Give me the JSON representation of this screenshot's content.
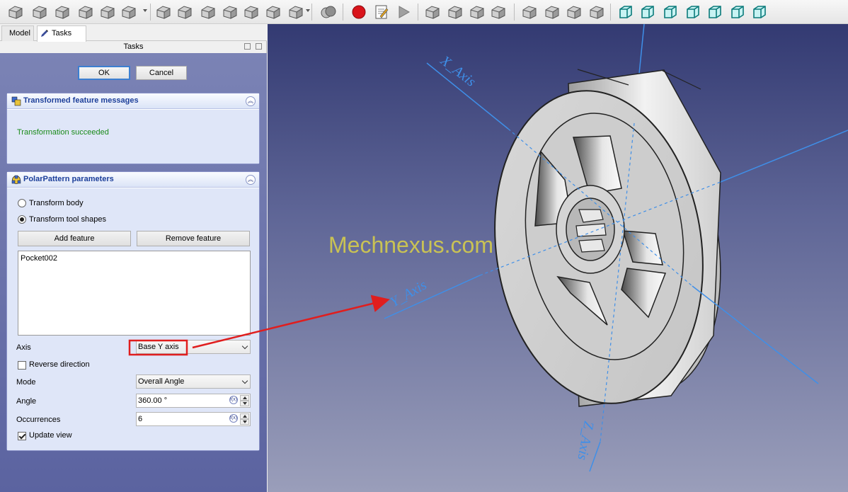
{
  "toolbar": {
    "icons": [
      "pad-icon",
      "revolution-icon",
      "additive-loft-icon",
      "additive-pipe-icon",
      "additive-helix-icon",
      "additive-primitive-icon",
      "pocket-icon",
      "hole-icon",
      "groove-icon",
      "subtractive-loft-icon",
      "subtractive-pipe-icon",
      "subtractive-helix-icon",
      "subtractive-primitive-icon",
      "boolean-icon",
      "macro-record-icon",
      "macro-edit-icon",
      "macro-execute-icon",
      "fillet-icon",
      "chamfer-icon",
      "draft-icon",
      "thickness-icon",
      "mirrored-icon",
      "linear-pattern-icon",
      "polar-pattern-icon",
      "multi-transform-icon",
      "view-isometric-icon",
      "view-front-icon",
      "view-top-icon",
      "view-right-icon",
      "view-rear-icon",
      "view-bottom-icon",
      "view-left-icon"
    ]
  },
  "tabs": {
    "model": "Model",
    "tasks": "Tasks"
  },
  "tasks_header": "Tasks",
  "dialog": {
    "ok": "OK",
    "cancel": "Cancel"
  },
  "messages": {
    "title": "Transformed feature messages",
    "text": "Transformation succeeded"
  },
  "params": {
    "title": "PolarPattern parameters",
    "transform_body": "Transform body",
    "transform_tool_shapes": "Transform tool shapes",
    "add_feature": "Add feature",
    "remove_feature": "Remove feature",
    "features": [
      "Pocket002"
    ],
    "axis_label": "Axis",
    "axis_value": "Base Y axis",
    "reverse_label": "Reverse direction",
    "mode_label": "Mode",
    "mode_value": "Overall Angle",
    "angle_label": "Angle",
    "angle_value": "360.00 °",
    "occurrences_label": "Occurrences",
    "occurrences_value": "6",
    "update_view_label": "Update view",
    "transform_mode_selected": "Transform tool shapes",
    "reverse_checked": false,
    "update_view_checked": true
  },
  "viewport": {
    "watermark": "Mechnexus.com",
    "x_axis_label": "X_Axis",
    "y_axis_label": "Y_Axis",
    "z_axis_label": "Z_Axis"
  },
  "colors": {
    "axis_line": "#3f8fe8",
    "arrow": "#e01e1e",
    "success_text": "#1a8a1a",
    "panel_title": "#1c3f9a"
  }
}
